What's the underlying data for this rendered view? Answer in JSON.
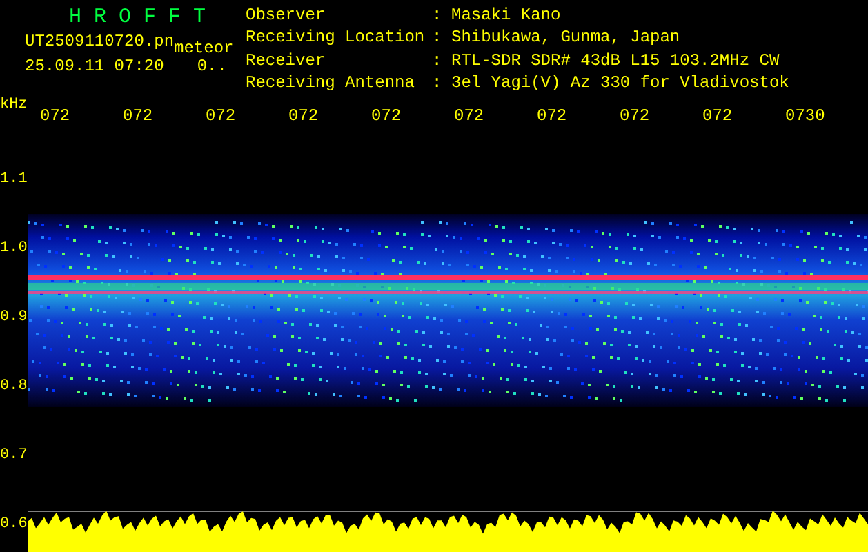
{
  "app_title": "H R O F F T",
  "file": {
    "name": "UT2509110720.pn",
    "type": "meteor",
    "timestamp": "25.09.11 07:20",
    "counter": "0.."
  },
  "station_info": [
    {
      "label": "Observer",
      "separator": ":",
      "value": "Masaki Kano"
    },
    {
      "label": "Receiving Location",
      "separator": ":",
      "value": "Shibukawa, Gunma, Japan"
    },
    {
      "label": "Receiver",
      "separator": ":",
      "value": "RTL-SDR SDR# 43dB L15 103.2MHz CW"
    },
    {
      "label": "Receiving Antenna",
      "separator": ":",
      "value": "3el Yagi(V) Az 330 for Vladivostok"
    }
  ],
  "plot": {
    "y_unit": "kHz",
    "x_labels": [
      "072",
      "072",
      "072",
      "072",
      "072",
      "072",
      "072",
      "072",
      "072",
      "0730"
    ],
    "y_labels": [
      "1.1",
      "1.0",
      "0.9",
      "0.8",
      "0.7",
      "0.6"
    ]
  }
}
